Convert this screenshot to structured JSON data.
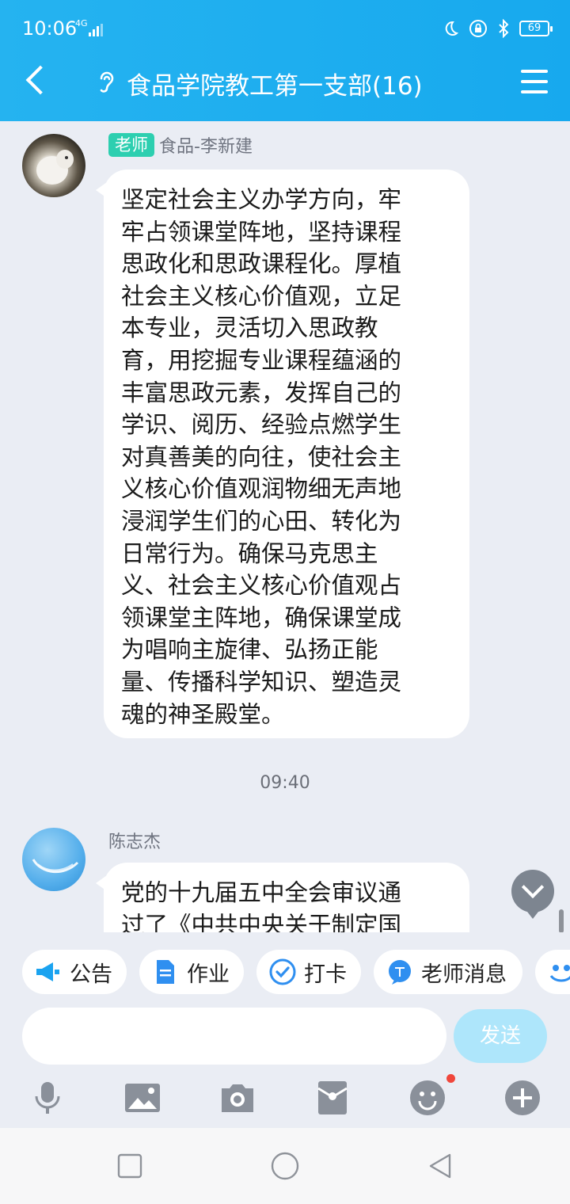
{
  "status_bar": {
    "time": "10:06",
    "network": "4G",
    "battery": "69"
  },
  "header": {
    "title": "食品学院教工第一支部(16)"
  },
  "messages": [
    {
      "role_badge": "老师",
      "sender": "食品-李新建",
      "lines": [
        "坚定社会主义办学方向，牢",
        "牢占领课堂阵地，坚持课程",
        "思政化和思政课程化。厚植",
        "社会主义核心价值观，立足",
        "本专业，灵活切入思政教",
        "育，用挖掘专业课程蕴涵的",
        "丰富思政元素，发挥自己的",
        "学识、阅历、经验点燃学生",
        "对真善美的向往，使社会主",
        "义核心价值观润物细无声地",
        "浸润学生们的心田、转化为",
        "日常行为。确保马克思主",
        "义、社会主义核心价值观占",
        "领课堂主阵地，确保课堂成",
        "为唱响主旋律、弘扬正能",
        "量、传播科学知识、塑造灵",
        "魂的神圣殿堂。"
      ]
    },
    {
      "sender": "陈志杰",
      "lines": [
        "党的十九届五中全会审议通",
        "过了《中共中央关于制定国"
      ]
    }
  ],
  "timestamp": "09:40",
  "quick_actions": [
    {
      "label": "公告",
      "icon": "megaphone-icon"
    },
    {
      "label": "作业",
      "icon": "document-icon"
    },
    {
      "label": "打卡",
      "icon": "check-circle-icon"
    },
    {
      "label": "老师消息",
      "icon": "teacher-chat-icon"
    }
  ],
  "input": {
    "value": "",
    "placeholder": ""
  },
  "send_label": "发送",
  "colors": {
    "header": "#1aabee",
    "accent": "#2dcfb0",
    "send_disabled": "#aee6fb"
  }
}
